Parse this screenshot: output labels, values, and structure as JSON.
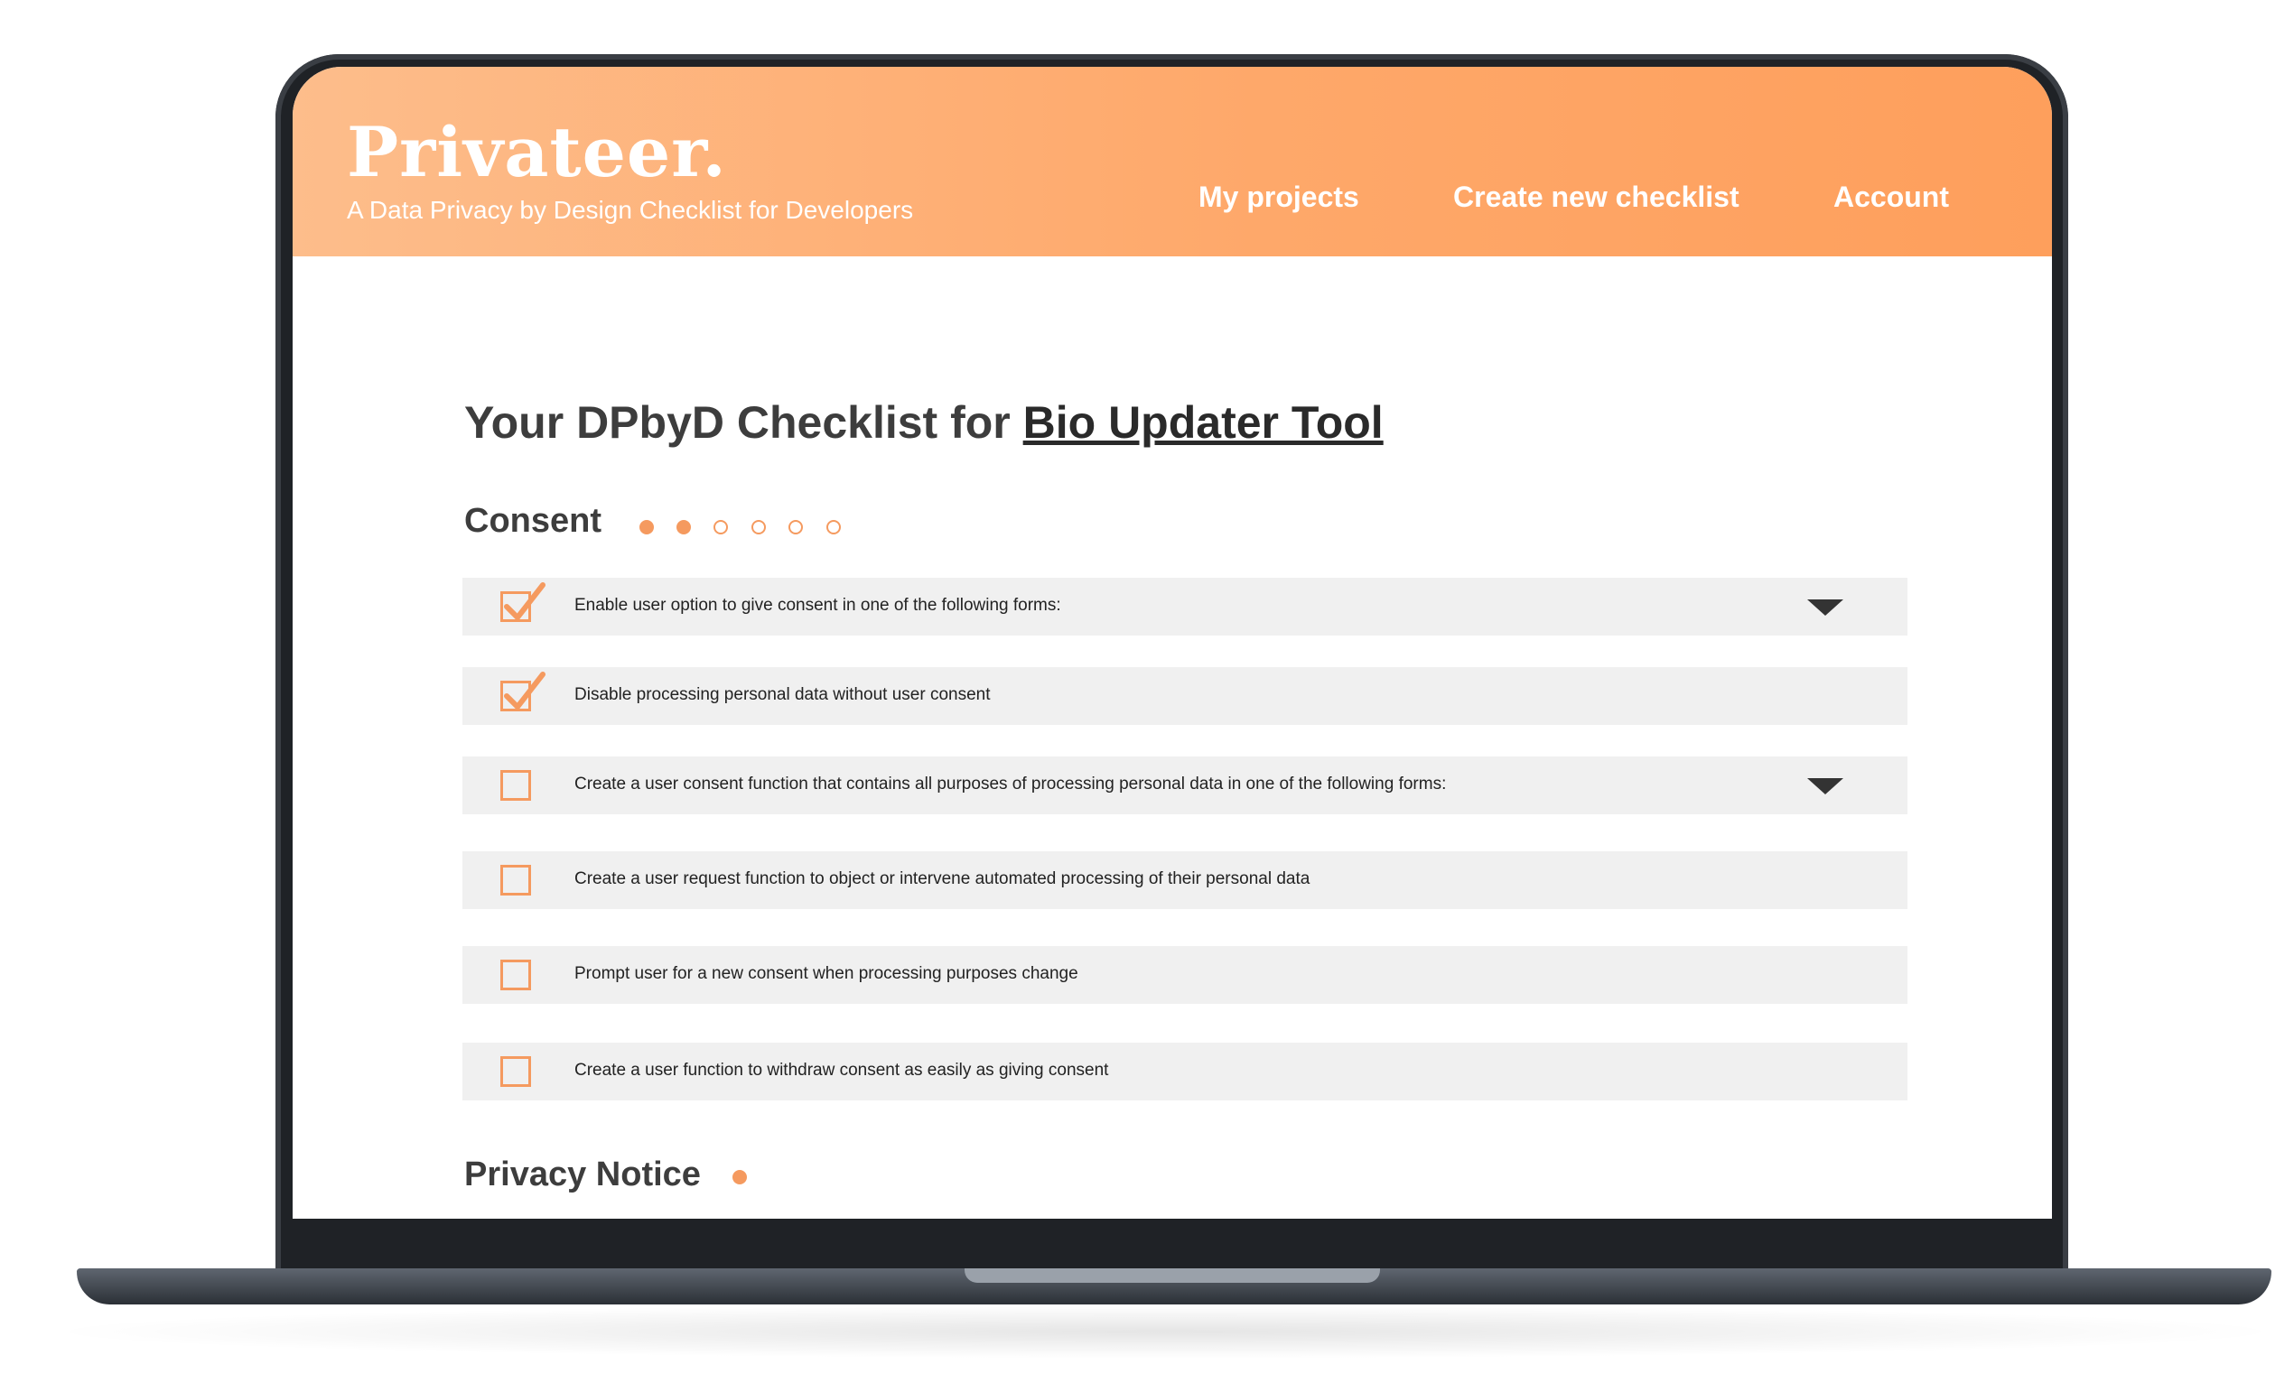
{
  "header": {
    "brand": "Privateer.",
    "tagline": "A Data Privacy by Design Checklist for Developers",
    "nav": [
      "My projects",
      "Create new checklist",
      "Account"
    ]
  },
  "page": {
    "title_prefix": "Your DPbyD Checklist for ",
    "project_name": "Bio Updater Tool"
  },
  "sections": [
    {
      "title": "Consent",
      "progress": {
        "completed": 2,
        "total": 6
      },
      "items": [
        {
          "text": "Enable user option to give consent in one of the following forms:",
          "checked": true,
          "expandable": true
        },
        {
          "text": "Disable processing personal data without user consent",
          "checked": true,
          "expandable": false
        },
        {
          "text": "Create a user consent function that contains all purposes of processing personal data in one of the following forms:",
          "checked": false,
          "expandable": true
        },
        {
          "text": "Create a user request function to object or intervene automated processing of their personal data",
          "checked": false,
          "expandable": false
        },
        {
          "text": "Prompt user for a new consent when processing purposes change",
          "checked": false,
          "expandable": false
        },
        {
          "text": "Create a user function to withdraw consent as easily as giving consent",
          "checked": false,
          "expandable": false
        }
      ]
    },
    {
      "title": "Privacy Notice",
      "progress": {
        "completed": 1,
        "total": 1
      }
    }
  ],
  "colors": {
    "accent": "#f59a5f",
    "header_start": "#fdbd8b",
    "header_end": "#fe9f5c",
    "row_bg": "#f0f0f0",
    "bezel": "#1f2226"
  },
  "icons": {
    "checkmark": "check-icon",
    "expand": "caret-down-icon",
    "progress": "dot-icon"
  }
}
